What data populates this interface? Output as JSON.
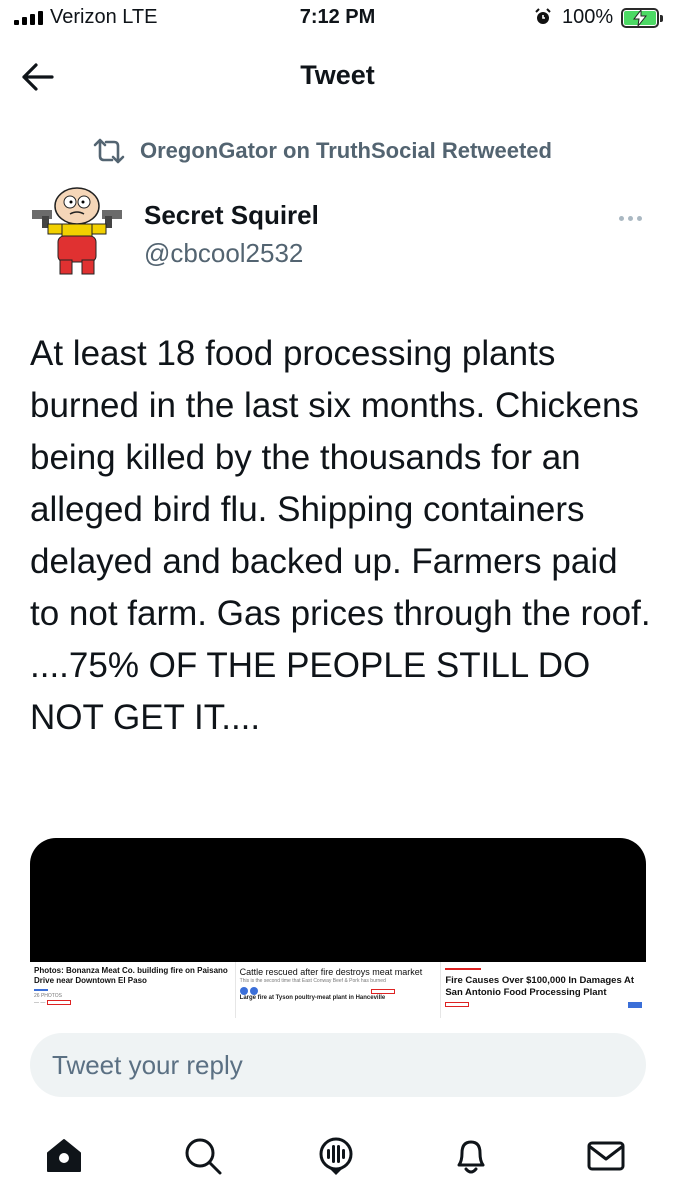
{
  "status_bar": {
    "carrier": "Verizon  LTE",
    "time": "7:12 PM",
    "battery_percent": "100%",
    "battery_color": "#4cd964"
  },
  "header": {
    "title": "Tweet",
    "back_icon": "arrow-left-icon"
  },
  "retweet_context": {
    "icon": "retweet-icon",
    "text": "OregonGator on TruthSocial Retweeted"
  },
  "author": {
    "name": "Secret Squirel",
    "handle": "@cbcool2532",
    "avatar_icon": "cartoon-avatar"
  },
  "tweet": {
    "text": "At least 18 food processing plants burned in the last six months. Chickens being killed by the thousands for an alleged bird flu. Shipping containers delayed and backed up.  Farmers paid to not farm.  Gas prices through the roof. ....75% OF THE PEOPLE STILL DO NOT GET IT...."
  },
  "media": {
    "col1": {
      "title": "Photos: Bonanza Meat Co. building fire on Paisano Drive near Downtown El Paso",
      "meta": "26 PHOTOS"
    },
    "col2": {
      "title": "Cattle rescued after fire destroys meat market",
      "subtitle": "This is the second time that East Conway Beef & Pork has burned",
      "bottom": "Large fire at Tyson poultry-meat plant in Hanceville"
    },
    "col3": {
      "title": "Fire Causes Over $100,000 In Damages At San Antonio Food Processing Plant"
    }
  },
  "reply": {
    "placeholder": "Tweet your reply"
  },
  "nav": {
    "items": [
      "home-icon",
      "search-icon",
      "spaces-icon",
      "notifications-icon",
      "messages-icon"
    ]
  },
  "colors": {
    "text_primary": "#0f1419",
    "text_secondary": "#536471",
    "reply_bg": "#eff3f4"
  }
}
